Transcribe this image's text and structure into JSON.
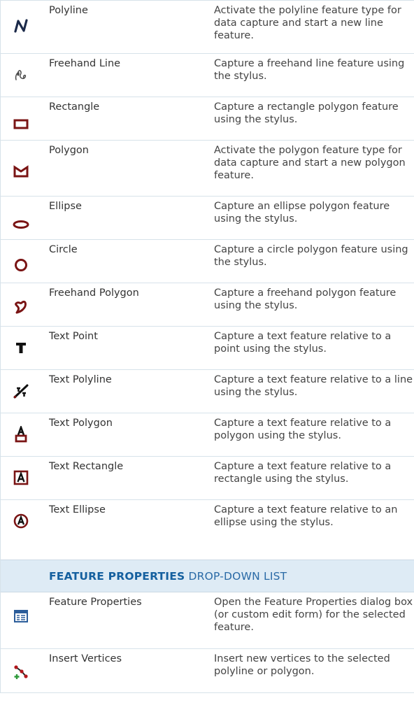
{
  "tools": [
    {
      "icon": "polyline-icon",
      "name": "Polyline",
      "description": "Activate the polyline feature type for data capture and start a new line feature."
    },
    {
      "icon": "freehand-line-icon",
      "name": "Freehand Line",
      "description": "Capture a freehand line feature using the stylus."
    },
    {
      "icon": "rectangle-icon",
      "name": "Rectangle",
      "description": "Capture a rectangle polygon feature using the stylus."
    },
    {
      "icon": "polygon-icon",
      "name": "Polygon",
      "description": "Activate the polygon feature type for data capture and start a new polygon feature."
    },
    {
      "icon": "ellipse-icon",
      "name": "Ellipse",
      "description": "Capture an ellipse polygon feature using the stylus."
    },
    {
      "icon": "circle-icon",
      "name": "Circle",
      "description": "Capture a circle polygon feature using the stylus."
    },
    {
      "icon": "freehand-polygon-icon",
      "name": "Freehand Polygon",
      "description": "Capture a freehand polygon feature using the stylus."
    },
    {
      "icon": "text-point-icon",
      "name": "Text Point",
      "description": "Capture a text feature relative to a point using the stylus."
    },
    {
      "icon": "text-polyline-icon",
      "name": "Text Polyline",
      "description": "Capture a text feature relative to a line using the stylus."
    },
    {
      "icon": "text-polygon-icon",
      "name": "Text Polygon",
      "description": "Capture a text feature relative to a polygon using the stylus."
    },
    {
      "icon": "text-rectangle-icon",
      "name": "Text Rectangle",
      "description": "Capture a text feature relative to a rectangle using the stylus."
    },
    {
      "icon": "text-ellipse-icon",
      "name": "Text Ellipse",
      "description": "Capture a text feature relative to an ellipse using the stylus."
    }
  ],
  "section": {
    "title_strong": "FEATURE PROPERTIES",
    "title_rest": "DROP-DOWN LIST"
  },
  "properties": [
    {
      "icon": "feature-properties-icon",
      "name": "Feature Properties",
      "description": "Open the Feature Properties dialog box (or custom edit form) for the selected feature."
    },
    {
      "icon": "insert-vertices-icon",
      "name": "Insert Vertices",
      "description": "Insert new vertices to the selected polyline or polygon."
    }
  ],
  "colors": {
    "accent_dark_red": "#7a1414",
    "header_bg": "#deebf5",
    "header_text": "#15609f",
    "rule": "#d7e2ea"
  }
}
